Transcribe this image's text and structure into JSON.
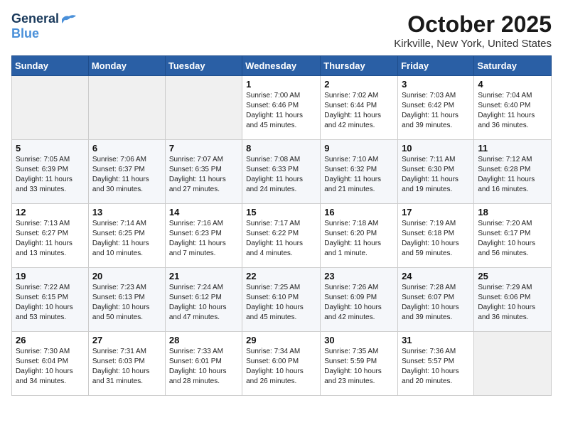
{
  "logo": {
    "general": "General",
    "blue": "Blue"
  },
  "title": "October 2025",
  "location": "Kirkville, New York, United States",
  "weekdays": [
    "Sunday",
    "Monday",
    "Tuesday",
    "Wednesday",
    "Thursday",
    "Friday",
    "Saturday"
  ],
  "weeks": [
    [
      {
        "day": "",
        "sunrise": "",
        "sunset": "",
        "daylight": ""
      },
      {
        "day": "",
        "sunrise": "",
        "sunset": "",
        "daylight": ""
      },
      {
        "day": "",
        "sunrise": "",
        "sunset": "",
        "daylight": ""
      },
      {
        "day": "1",
        "sunrise": "Sunrise: 7:00 AM",
        "sunset": "Sunset: 6:46 PM",
        "daylight": "Daylight: 11 hours and 45 minutes."
      },
      {
        "day": "2",
        "sunrise": "Sunrise: 7:02 AM",
        "sunset": "Sunset: 6:44 PM",
        "daylight": "Daylight: 11 hours and 42 minutes."
      },
      {
        "day": "3",
        "sunrise": "Sunrise: 7:03 AM",
        "sunset": "Sunset: 6:42 PM",
        "daylight": "Daylight: 11 hours and 39 minutes."
      },
      {
        "day": "4",
        "sunrise": "Sunrise: 7:04 AM",
        "sunset": "Sunset: 6:40 PM",
        "daylight": "Daylight: 11 hours and 36 minutes."
      }
    ],
    [
      {
        "day": "5",
        "sunrise": "Sunrise: 7:05 AM",
        "sunset": "Sunset: 6:39 PM",
        "daylight": "Daylight: 11 hours and 33 minutes."
      },
      {
        "day": "6",
        "sunrise": "Sunrise: 7:06 AM",
        "sunset": "Sunset: 6:37 PM",
        "daylight": "Daylight: 11 hours and 30 minutes."
      },
      {
        "day": "7",
        "sunrise": "Sunrise: 7:07 AM",
        "sunset": "Sunset: 6:35 PM",
        "daylight": "Daylight: 11 hours and 27 minutes."
      },
      {
        "day": "8",
        "sunrise": "Sunrise: 7:08 AM",
        "sunset": "Sunset: 6:33 PM",
        "daylight": "Daylight: 11 hours and 24 minutes."
      },
      {
        "day": "9",
        "sunrise": "Sunrise: 7:10 AM",
        "sunset": "Sunset: 6:32 PM",
        "daylight": "Daylight: 11 hours and 21 minutes."
      },
      {
        "day": "10",
        "sunrise": "Sunrise: 7:11 AM",
        "sunset": "Sunset: 6:30 PM",
        "daylight": "Daylight: 11 hours and 19 minutes."
      },
      {
        "day": "11",
        "sunrise": "Sunrise: 7:12 AM",
        "sunset": "Sunset: 6:28 PM",
        "daylight": "Daylight: 11 hours and 16 minutes."
      }
    ],
    [
      {
        "day": "12",
        "sunrise": "Sunrise: 7:13 AM",
        "sunset": "Sunset: 6:27 PM",
        "daylight": "Daylight: 11 hours and 13 minutes."
      },
      {
        "day": "13",
        "sunrise": "Sunrise: 7:14 AM",
        "sunset": "Sunset: 6:25 PM",
        "daylight": "Daylight: 11 hours and 10 minutes."
      },
      {
        "day": "14",
        "sunrise": "Sunrise: 7:16 AM",
        "sunset": "Sunset: 6:23 PM",
        "daylight": "Daylight: 11 hours and 7 minutes."
      },
      {
        "day": "15",
        "sunrise": "Sunrise: 7:17 AM",
        "sunset": "Sunset: 6:22 PM",
        "daylight": "Daylight: 11 hours and 4 minutes."
      },
      {
        "day": "16",
        "sunrise": "Sunrise: 7:18 AM",
        "sunset": "Sunset: 6:20 PM",
        "daylight": "Daylight: 11 hours and 1 minute."
      },
      {
        "day": "17",
        "sunrise": "Sunrise: 7:19 AM",
        "sunset": "Sunset: 6:18 PM",
        "daylight": "Daylight: 10 hours and 59 minutes."
      },
      {
        "day": "18",
        "sunrise": "Sunrise: 7:20 AM",
        "sunset": "Sunset: 6:17 PM",
        "daylight": "Daylight: 10 hours and 56 minutes."
      }
    ],
    [
      {
        "day": "19",
        "sunrise": "Sunrise: 7:22 AM",
        "sunset": "Sunset: 6:15 PM",
        "daylight": "Daylight: 10 hours and 53 minutes."
      },
      {
        "day": "20",
        "sunrise": "Sunrise: 7:23 AM",
        "sunset": "Sunset: 6:13 PM",
        "daylight": "Daylight: 10 hours and 50 minutes."
      },
      {
        "day": "21",
        "sunrise": "Sunrise: 7:24 AM",
        "sunset": "Sunset: 6:12 PM",
        "daylight": "Daylight: 10 hours and 47 minutes."
      },
      {
        "day": "22",
        "sunrise": "Sunrise: 7:25 AM",
        "sunset": "Sunset: 6:10 PM",
        "daylight": "Daylight: 10 hours and 45 minutes."
      },
      {
        "day": "23",
        "sunrise": "Sunrise: 7:26 AM",
        "sunset": "Sunset: 6:09 PM",
        "daylight": "Daylight: 10 hours and 42 minutes."
      },
      {
        "day": "24",
        "sunrise": "Sunrise: 7:28 AM",
        "sunset": "Sunset: 6:07 PM",
        "daylight": "Daylight: 10 hours and 39 minutes."
      },
      {
        "day": "25",
        "sunrise": "Sunrise: 7:29 AM",
        "sunset": "Sunset: 6:06 PM",
        "daylight": "Daylight: 10 hours and 36 minutes."
      }
    ],
    [
      {
        "day": "26",
        "sunrise": "Sunrise: 7:30 AM",
        "sunset": "Sunset: 6:04 PM",
        "daylight": "Daylight: 10 hours and 34 minutes."
      },
      {
        "day": "27",
        "sunrise": "Sunrise: 7:31 AM",
        "sunset": "Sunset: 6:03 PM",
        "daylight": "Daylight: 10 hours and 31 minutes."
      },
      {
        "day": "28",
        "sunrise": "Sunrise: 7:33 AM",
        "sunset": "Sunset: 6:01 PM",
        "daylight": "Daylight: 10 hours and 28 minutes."
      },
      {
        "day": "29",
        "sunrise": "Sunrise: 7:34 AM",
        "sunset": "Sunset: 6:00 PM",
        "daylight": "Daylight: 10 hours and 26 minutes."
      },
      {
        "day": "30",
        "sunrise": "Sunrise: 7:35 AM",
        "sunset": "Sunset: 5:59 PM",
        "daylight": "Daylight: 10 hours and 23 minutes."
      },
      {
        "day": "31",
        "sunrise": "Sunrise: 7:36 AM",
        "sunset": "Sunset: 5:57 PM",
        "daylight": "Daylight: 10 hours and 20 minutes."
      },
      {
        "day": "",
        "sunrise": "",
        "sunset": "",
        "daylight": ""
      }
    ]
  ]
}
